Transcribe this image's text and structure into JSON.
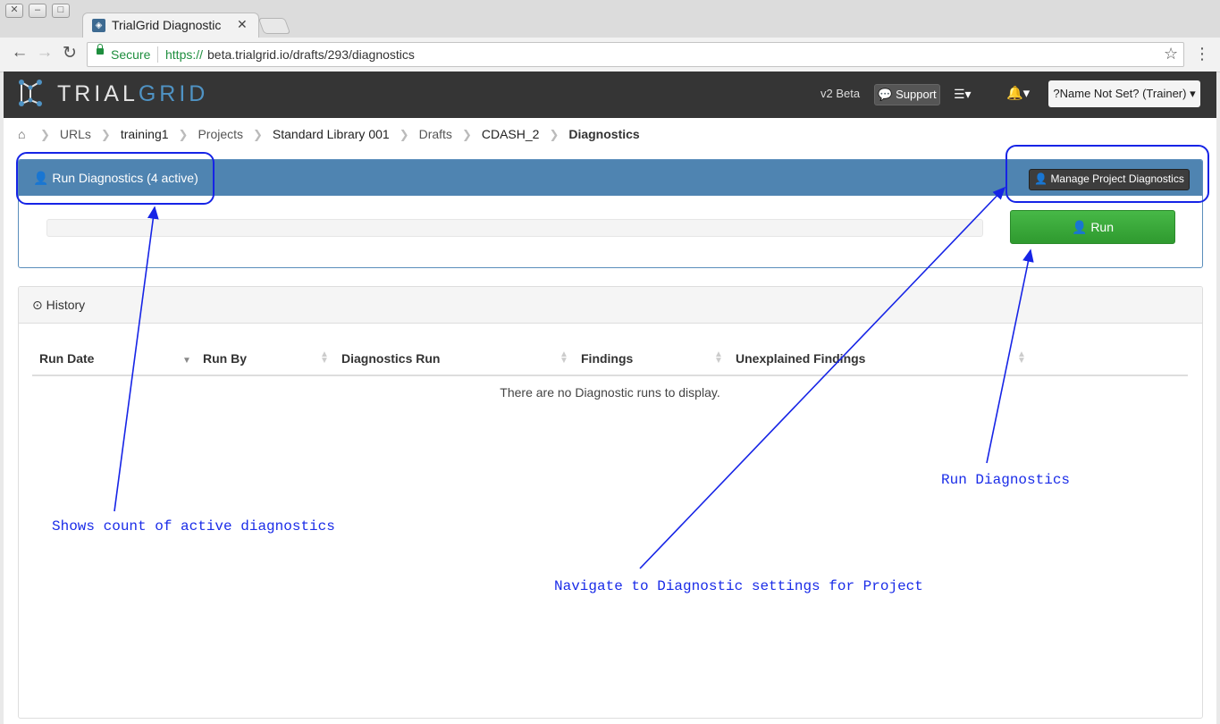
{
  "browser": {
    "tab_title": "TrialGrid Diagnostic",
    "secure_label": "Secure",
    "url_scheme": "https://",
    "url_host_path": "beta.trialgrid.io/drafts/293/diagnostics"
  },
  "header": {
    "logo_left": "TRIAL",
    "logo_right": "GRID",
    "version": "v2 Beta",
    "support_label": "Support",
    "user_menu": "?Name Not Set? (Trainer)"
  },
  "breadcrumb": {
    "items": [
      {
        "label": "URLs"
      },
      {
        "label": "training1"
      },
      {
        "label": "Projects"
      },
      {
        "label": "Standard Library 001"
      },
      {
        "label": "Drafts"
      },
      {
        "label": "CDASH_2"
      },
      {
        "label": "Diagnostics"
      }
    ]
  },
  "run_panel": {
    "title": "Run Diagnostics (4 active)",
    "manage_button": "Manage Project Diagnostics",
    "run_button": "Run",
    "progress": 0
  },
  "history": {
    "title": "History",
    "columns": [
      "Run Date",
      "Run By",
      "Diagnostics Run",
      "Findings",
      "Unexplained Findings"
    ],
    "rows": [],
    "empty_message": "There are no Diagnostic runs to display."
  },
  "annotations": {
    "active_count": "Shows count of active diagnostics",
    "manage": "Navigate to Diagnostic settings for Project",
    "run": "Run Diagnostics"
  },
  "colors": {
    "header_bg": "#353535",
    "panel_primary": "#4f84b1",
    "run_button": "#3aab3a",
    "annotation": "#1624e6",
    "brand_accent": "#4f93c4"
  }
}
